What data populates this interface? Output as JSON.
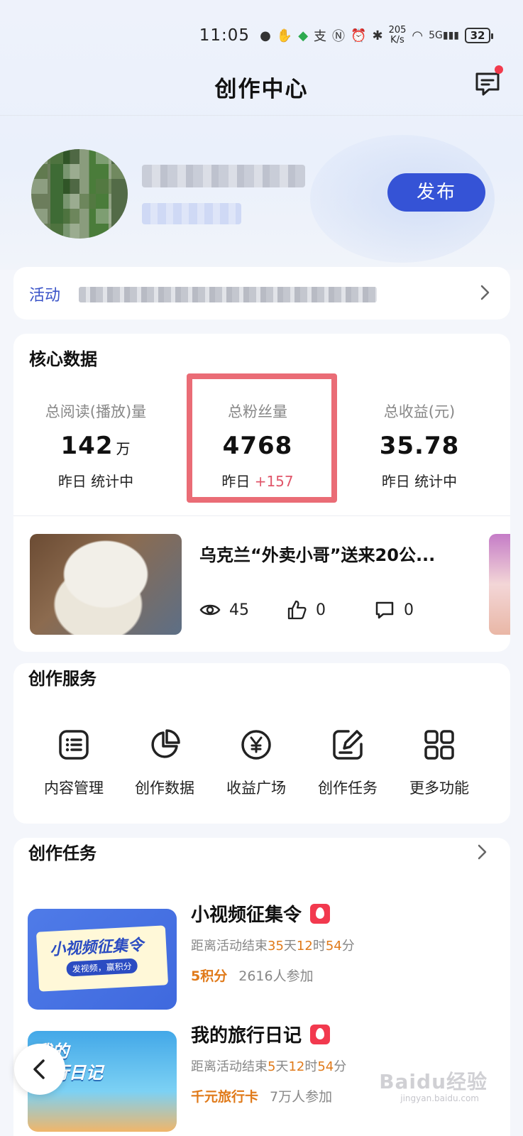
{
  "status_bar": {
    "time": "11:05",
    "net_speed_top": "205",
    "net_speed_bottom": "K/s",
    "signal": "5G",
    "battery": "32"
  },
  "header": {
    "title": "创作中心"
  },
  "profile": {
    "publish_label": "发布"
  },
  "activity": {
    "label": "活动"
  },
  "core_data": {
    "title": "核心数据",
    "stats": [
      {
        "label": "总阅读(播放)量",
        "value": "142",
        "unit": "万",
        "sub_prefix": "昨日",
        "sub_value": "统计中"
      },
      {
        "label": "总粉丝量",
        "value": "4768",
        "unit": "",
        "sub_prefix": "昨日",
        "sub_value": "+157"
      },
      {
        "label": "总收益(元)",
        "value": "35.78",
        "unit": "",
        "sub_prefix": "昨日",
        "sub_value": "统计中"
      }
    ],
    "video": {
      "title": "乌克兰“外卖小哥”送来20公...",
      "views": "45",
      "likes": "0",
      "comments": "0"
    }
  },
  "services": {
    "title": "创作服务",
    "items": [
      {
        "label": "内容管理",
        "icon": "list-icon"
      },
      {
        "label": "创作数据",
        "icon": "pie-chart-icon"
      },
      {
        "label": "收益广场",
        "icon": "yen-icon"
      },
      {
        "label": "创作任务",
        "icon": "edit-icon"
      },
      {
        "label": "更多功能",
        "icon": "grid-icon"
      }
    ]
  },
  "tasks": {
    "title": "创作任务",
    "items": [
      {
        "name": "小视频征集令",
        "countdown_prefix": "距离活动结束",
        "days": "35",
        "days_unit": "天",
        "hours": "12",
        "hours_unit": "时",
        "minutes": "54",
        "minutes_unit": "分",
        "reward": "5积分",
        "participants": "2616人参加",
        "thumb_text": "小视频征集令",
        "thumb_sub": "发视频，赢积分"
      },
      {
        "name": "我的旅行日记",
        "countdown_prefix": "距离活动结束",
        "days": "5",
        "days_unit": "天",
        "hours": "12",
        "hours_unit": "时",
        "minutes": "54",
        "minutes_unit": "分",
        "reward": "千元旅行卡",
        "participants": "7万人参加",
        "thumb_text_1": "我的",
        "thumb_text_2": "旅行日记"
      }
    ]
  },
  "watermark": {
    "text": "Baidu经验",
    "sub": "jingyan.baidu.com"
  },
  "colors": {
    "accent": "#3553d6",
    "highlight_box": "#ea6c76",
    "hot": "#f2394e",
    "reward": "#e07a1a"
  }
}
